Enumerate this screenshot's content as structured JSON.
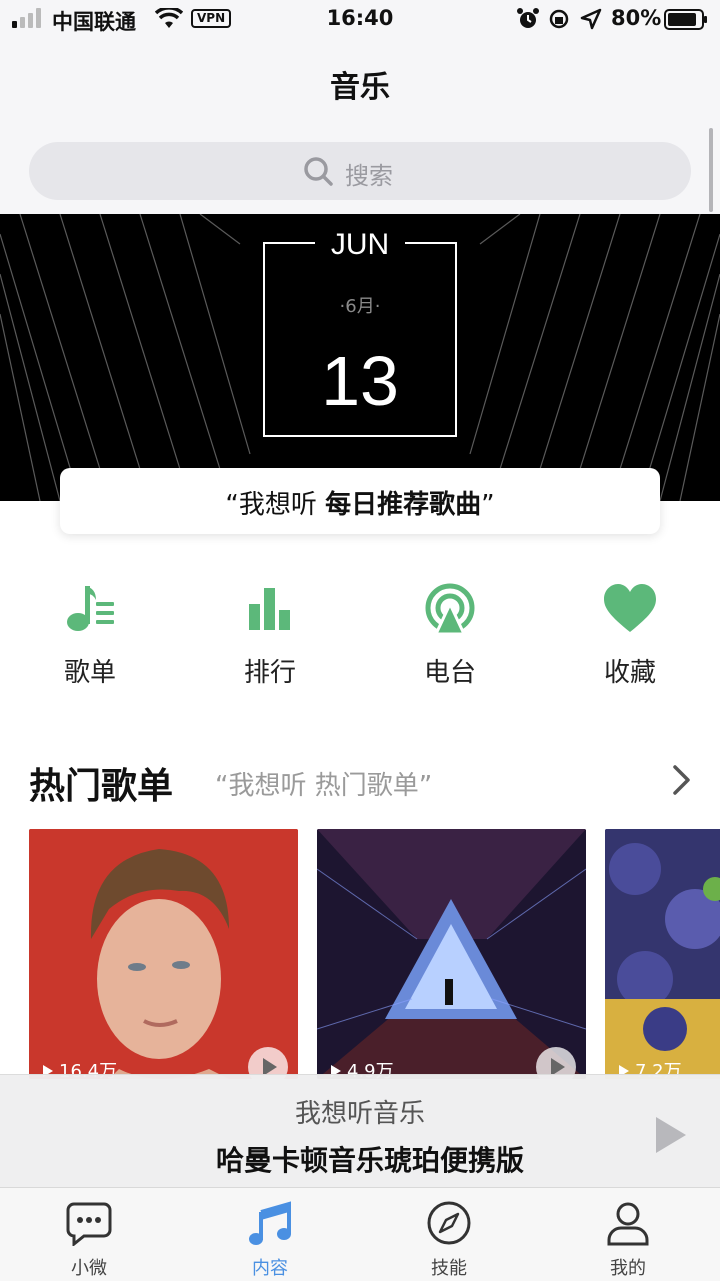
{
  "status_bar": {
    "carrier": "中国联通",
    "vpn": "VPN",
    "time": "16:40",
    "battery": "80%"
  },
  "header": {
    "title": "音乐"
  },
  "search": {
    "placeholder": "搜索"
  },
  "banner": {
    "month_en": "JUN",
    "month_cn": "·6月·",
    "day": "13",
    "quote_prefix": "“我想听 ",
    "quote_bold": "每日推荐歌曲",
    "quote_suffix": "”"
  },
  "quick_nav": [
    {
      "label": "歌单",
      "icon": "playlist-icon"
    },
    {
      "label": "排行",
      "icon": "chart-icon"
    },
    {
      "label": "电台",
      "icon": "radio-icon"
    },
    {
      "label": "收藏",
      "icon": "heart-icon"
    }
  ],
  "hot": {
    "title": "热门歌单",
    "subtitle": "“我想听 热门歌单”",
    "playlists": [
      {
        "count": "16.4万"
      },
      {
        "count": "4.9万"
      },
      {
        "count": "7.2万"
      }
    ]
  },
  "player": {
    "app": "我想听音乐",
    "song": "哈曼卡顿音乐琥珀便携版"
  },
  "tabs": [
    {
      "label": "小微",
      "icon": "chat-icon",
      "active": false
    },
    {
      "label": "内容",
      "icon": "music-note-icon",
      "active": true
    },
    {
      "label": "技能",
      "icon": "compass-icon",
      "active": false
    },
    {
      "label": "我的",
      "icon": "person-icon",
      "active": false
    }
  ],
  "colors": {
    "accent_green": "#5cb87a",
    "active_blue": "#4a90e2"
  }
}
